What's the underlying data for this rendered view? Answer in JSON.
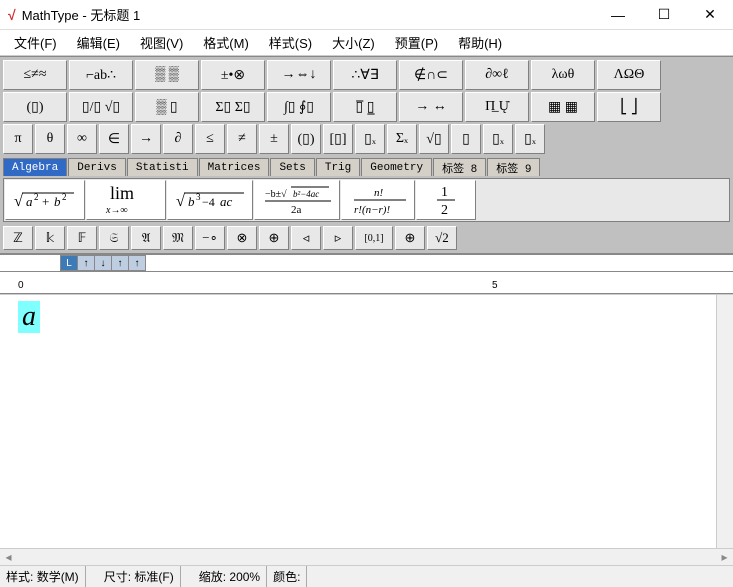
{
  "window": {
    "app_name": "MathType",
    "doc_title": "无标题 1"
  },
  "menu": {
    "file": "文件(F)",
    "edit": "编辑(E)",
    "view": "视图(V)",
    "format": "格式(M)",
    "style": "样式(S)",
    "size": "大小(Z)",
    "preset": "预置(P)",
    "help": "帮助(H)"
  },
  "palette_row1": [
    "≤≠≈",
    "⌐ab∴",
    "▒ ▒",
    "±•⊗",
    "→⇔↓",
    "∴∀∃",
    "∉∩⊂",
    "∂∞ℓ",
    "λωθ",
    "ΛΩΘ"
  ],
  "palette_row2": [
    "(▯)",
    "▯/▯ √▯",
    "▒ ▯",
    "Σ▯ Σ▯",
    "∫▯ ∮▯",
    "▯̅ ▯̲",
    "→ ↔",
    "Π̲ Ų̇",
    "▦ ▦",
    "⎣ ⎦"
  ],
  "palette_row3": [
    "π",
    "θ",
    "∞",
    "∈",
    "→",
    "∂",
    "≤",
    "≠",
    "±",
    "(▯)",
    "[▯]",
    "▯ₓ",
    "Σₓ",
    "√▯",
    "▯",
    "▯ₓ",
    "▯ₓ"
  ],
  "tabs": [
    "Algebra",
    "Derivs",
    "Statisti",
    "Matrices",
    "Sets",
    "Trig",
    "Geometry",
    "标签 8",
    "标签 9"
  ],
  "active_tab_index": 0,
  "templates": {
    "t0": "sqrt_a2_b2",
    "t1": "lim_x_inf",
    "t2": "sqrt_b2_4ac",
    "t3": "quad_frac",
    "t4": "binom_frac",
    "t5": "half"
  },
  "row4": [
    "ℤ",
    "𝕜",
    "𝔽",
    "𝔖",
    "𝔄",
    "𝔐",
    "−∘",
    "⊗",
    "⊕",
    "◃",
    "▹",
    "[0,1]",
    "⊕",
    "√2"
  ],
  "ruler": {
    "mark0": "0",
    "mark5": "5"
  },
  "editor": {
    "content": "a"
  },
  "status": {
    "style_label": "样式:",
    "style_value": "数学(M)",
    "size_label": "尺寸:",
    "size_value": "标准(F)",
    "zoom_label": "缩放:",
    "zoom_value": "200%",
    "color_label": "颜色:"
  }
}
